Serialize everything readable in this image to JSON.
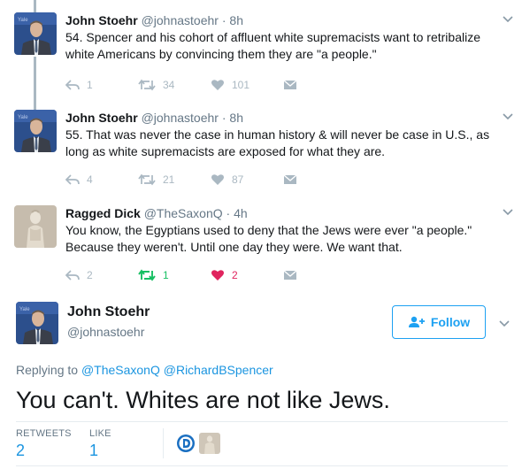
{
  "thread": [
    {
      "name": "John Stoehr",
      "handle": "@johnastoehr",
      "dot": "·",
      "time": "8h",
      "text": "54. Spencer and his cohort of affluent white supremacists want to retribalize white Americans by convincing them they are \"a people.\"",
      "replies": "1",
      "retweets": "34",
      "likes": "101",
      "avatar": "john-stoehr"
    },
    {
      "name": "John Stoehr",
      "handle": "@johnastoehr",
      "dot": "·",
      "time": "8h",
      "text": "55. That was never the case in human history & will never be case in U.S., as long as white supremacists are exposed for what they are.",
      "replies": "4",
      "retweets": "21",
      "likes": "87",
      "avatar": "john-stoehr"
    },
    {
      "name": "Ragged Dick",
      "handle": "@TheSaxonQ",
      "dot": "·",
      "time": "4h",
      "text": "You know, the Egyptians used to deny that the Jews were ever \"a people.\" Because they weren't. Until one day they were.  We want that.",
      "replies": "2",
      "retweets": "1",
      "likes": "2",
      "avatar": "statue"
    }
  ],
  "focused": {
    "name": "John Stoehr",
    "handle": "@johnastoehr",
    "follow_label": "Follow",
    "replying_prefix": "Replying to",
    "mention1": "@TheSaxonQ",
    "mention2": "@RichardBSpencer",
    "text": "You can't. Whites are not like Jews.",
    "retweets_label": "RETWEETS",
    "retweets_count": "2",
    "likes_label": "LIKE",
    "likes_count": "1"
  },
  "colors": {
    "accent": "#1da1f2",
    "link": "#1b95e0",
    "retweet_active": "#17bf63",
    "like_active": "#e0245e",
    "muted": "#657786",
    "icon_gray": "#aab8c2"
  },
  "icons": [
    "reply-icon",
    "retweet-icon",
    "heart-icon",
    "direct-message-icon",
    "chevron-down-icon",
    "add-user-icon"
  ]
}
